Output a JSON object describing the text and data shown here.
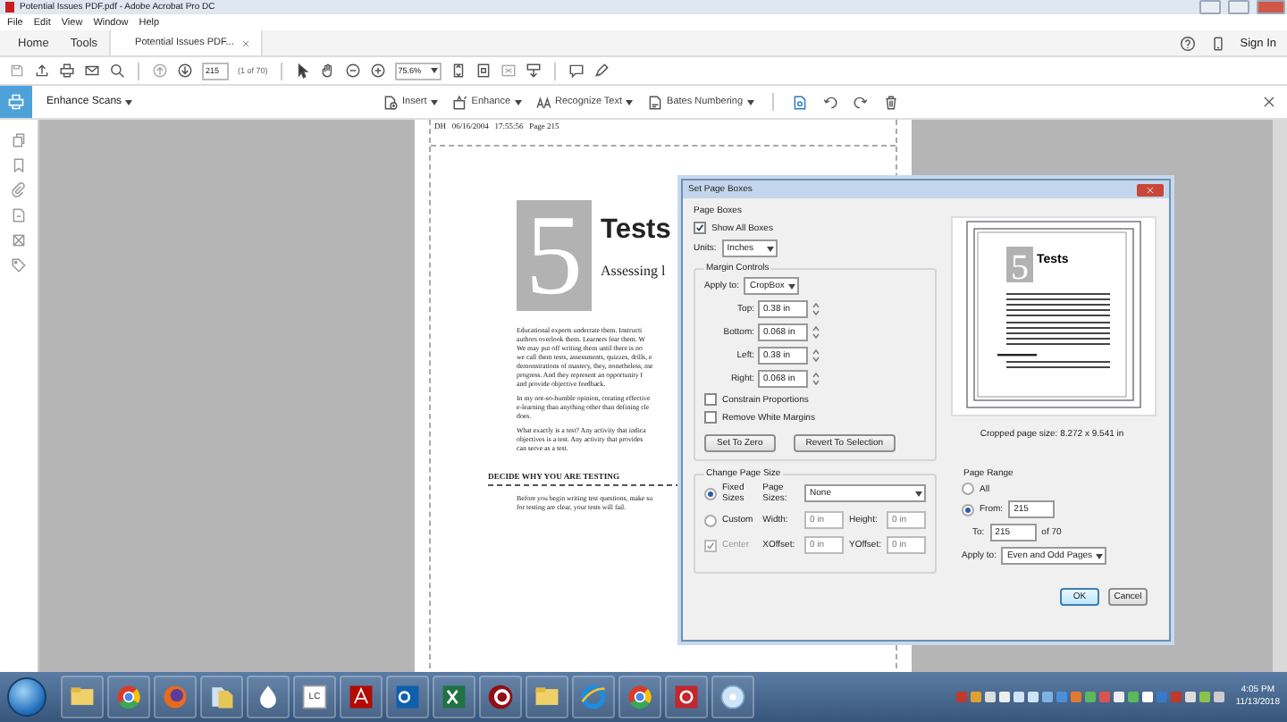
{
  "window": {
    "title": "Potential Issues PDF.pdf - Adobe Acrobat Pro DC"
  },
  "menu": [
    "File",
    "Edit",
    "View",
    "Window",
    "Help"
  ],
  "nav": [
    {
      "label": "Home",
      "selected": false,
      "closable": false
    },
    {
      "label": "Tools",
      "selected": false,
      "closable": false
    },
    {
      "label": "Potential Issues PDF...",
      "selected": true,
      "closable": true
    }
  ],
  "account": {
    "sign_in": "Sign In"
  },
  "toolbar": {
    "page": "215",
    "page_of": "(1 of 70)",
    "zoom": "75.6%"
  },
  "enhance_bar": {
    "title": "Enhance Scans",
    "tools": [
      "Insert",
      "Enhance",
      "Recognize Text",
      "Bates Numbering"
    ]
  },
  "document": {
    "header": "DH   06/16/2004   17:55:56   Page 215",
    "numeral": "5",
    "title": "Tests",
    "subtitle": "Assessing l",
    "paragraphs": [
      [
        "Educational experts underrate them. Instructi",
        "authors overlook them. Learners fear them. W",
        "We may put off writing them until there is no",
        "we call them tests, assessments, quizzes, drills, e",
        "demonstrations of mastery, they, nonetheless, me",
        "progress. And they represent an opportunity f",
        "and provide objective feedback."
      ],
      [
        "In my not-so-humble opinion, creating effective",
        "e-learning than anything other than defining cle",
        "does."
      ],
      [
        "What exactly is a test? Any activity that indica",
        "objectives is a test. Any activity that provides",
        "can serve as a test."
      ]
    ],
    "heading": "DECIDE WHY YOU ARE TESTING",
    "closing": [
      "Before you begin writing test questions, make su",
      "for testing are clear, your tests will fail."
    ]
  },
  "dialog": {
    "title": "Set Page Boxes",
    "page_boxes": "Page Boxes",
    "show_all": {
      "label": "Show All Boxes",
      "checked": true
    },
    "units": {
      "label": "Units:",
      "value": "Inches"
    },
    "margin": {
      "title": "Margin Controls",
      "apply": {
        "label": "Apply to:",
        "value": "CropBox"
      },
      "fields": [
        {
          "label": "Top:",
          "value": "0.38 in"
        },
        {
          "label": "Bottom:",
          "value": "0.068 in"
        },
        {
          "label": "Left:",
          "value": "0.38 in"
        },
        {
          "label": "Right:",
          "value": "0.068 in"
        }
      ],
      "checks": [
        {
          "label": "Constrain Proportions",
          "checked": false
        },
        {
          "label": "Remove White Margins",
          "checked": false
        }
      ],
      "buttons": [
        "Set To Zero",
        "Revert To Selection"
      ]
    },
    "preview": {
      "numeral": "5",
      "title": "Tests",
      "caption": "Cropped page size: 8.272 x 9.541 in"
    },
    "page_size": {
      "title": "Change Page Size",
      "options": [
        {
          "label": "Fixed Sizes",
          "selected": true
        },
        {
          "label": "Custom",
          "selected": false
        }
      ],
      "page_sizes": {
        "label": "Page Sizes:",
        "value": "None"
      },
      "width": {
        "label": "Width:",
        "value": "0 in",
        "disabled": true
      },
      "height": {
        "label": "Height:",
        "value": "0 in",
        "disabled": true
      },
      "center": {
        "label": "Center",
        "checked": true,
        "disabled": true
      },
      "xoffset": {
        "label": "XOffset:",
        "value": "0 in",
        "disabled": true
      },
      "yoffset": {
        "label": "YOffset:",
        "value": "0 in",
        "disabled": true
      }
    },
    "page_range": {
      "title": "Page Range",
      "all": {
        "label": "All",
        "selected": false
      },
      "from": {
        "label": "From:",
        "value": "215",
        "selected": true
      },
      "to": {
        "label": "To:",
        "value": "215"
      },
      "of": "of 70",
      "apply": {
        "label": "Apply to:",
        "value": "Even and Odd Pages"
      }
    },
    "buttons": [
      "OK",
      "Cancel"
    ]
  },
  "taskbar": {
    "apps": [
      {
        "kind": "folder"
      },
      {
        "kind": "chrome"
      },
      {
        "kind": "firefox"
      },
      {
        "kind": "files"
      },
      {
        "kind": "flame"
      },
      {
        "kind": "tile",
        "label": "LC"
      },
      {
        "kind": "acrobat"
      },
      {
        "kind": "outlook"
      },
      {
        "kind": "excel"
      },
      {
        "kind": "recorder"
      },
      {
        "kind": "folder"
      },
      {
        "kind": "ie"
      },
      {
        "kind": "chrome"
      },
      {
        "kind": "snip"
      },
      {
        "kind": "disc"
      }
    ],
    "time": "4:05 PM",
    "date": "11/13/2018"
  }
}
